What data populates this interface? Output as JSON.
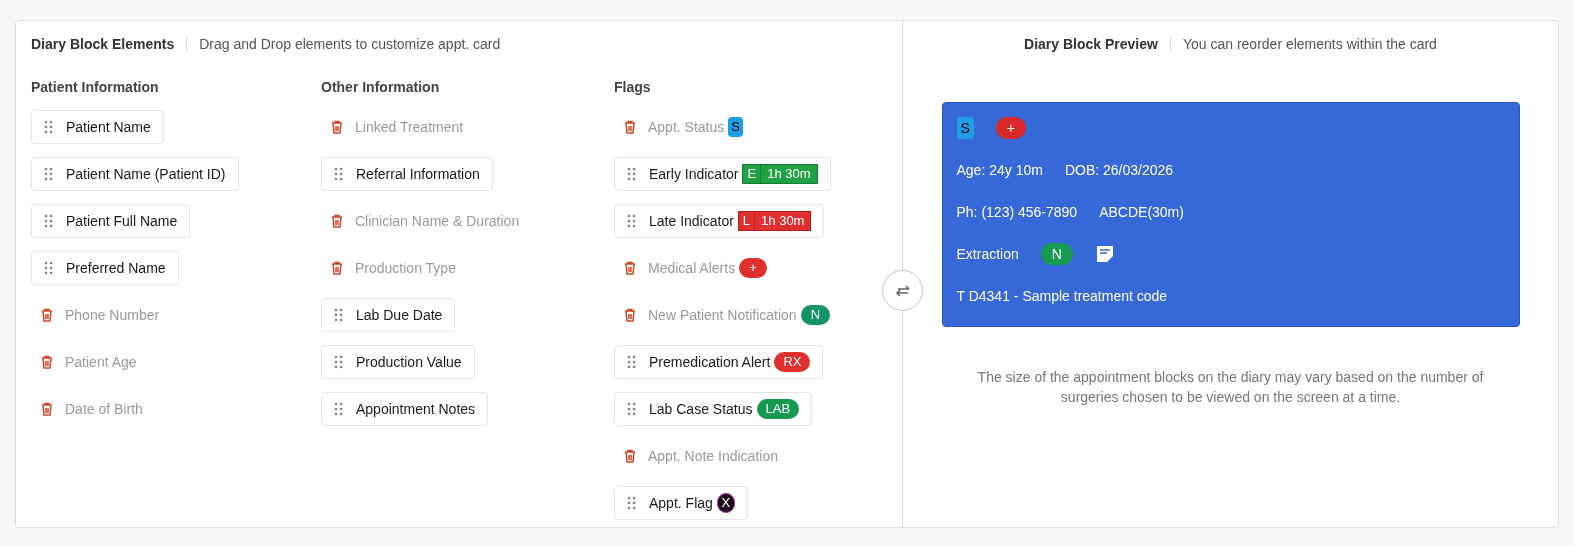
{
  "elements_panel": {
    "title": "Diary Block Elements",
    "subtitle": "Drag and Drop elements to customize appt. card",
    "columns": [
      {
        "heading": "Patient Information",
        "items": [
          {
            "label": "Patient Name",
            "enabled": true
          },
          {
            "label": "Patient Name (Patient ID)",
            "enabled": true
          },
          {
            "label": "Patient Full Name",
            "enabled": true
          },
          {
            "label": "Preferred Name",
            "enabled": true
          },
          {
            "label": "Phone Number",
            "enabled": false
          },
          {
            "label": "Patient Age",
            "enabled": false
          },
          {
            "label": "Date of Birth",
            "enabled": false
          }
        ]
      },
      {
        "heading": "Other Information",
        "items": [
          {
            "label": "Linked Treatment",
            "enabled": false
          },
          {
            "label": "Referral Information",
            "enabled": true
          },
          {
            "label": "Clinician Name & Duration",
            "enabled": false
          },
          {
            "label": "Production Type",
            "enabled": false
          },
          {
            "label": "Lab Due Date",
            "enabled": true
          },
          {
            "label": "Production Value",
            "enabled": true
          },
          {
            "label": "Appointment Notes",
            "enabled": true
          }
        ]
      },
      {
        "heading": "Flags",
        "items": [
          {
            "label": "Appt. Status",
            "enabled": false,
            "badge": {
              "kind": "status",
              "parts": [
                "S"
              ]
            }
          },
          {
            "label": "Early Indicator",
            "enabled": true,
            "badge": {
              "kind": "early",
              "parts": [
                "E",
                "1h 30m"
              ]
            }
          },
          {
            "label": "Late Indicator",
            "enabled": true,
            "badge": {
              "kind": "late",
              "parts": [
                "L",
                "1h 30m"
              ]
            }
          },
          {
            "label": "Medical Alerts",
            "enabled": false,
            "badge": {
              "kind": "alert",
              "parts": [
                "+"
              ]
            }
          },
          {
            "label": "New Patient Notification",
            "enabled": false,
            "badge": {
              "kind": "new",
              "parts": [
                "N"
              ]
            }
          },
          {
            "label": "Premedication Alert",
            "enabled": true,
            "badge": {
              "kind": "premed",
              "parts": [
                "RX"
              ]
            }
          },
          {
            "label": "Lab Case Status",
            "enabled": true,
            "badge": {
              "kind": "lab",
              "parts": [
                "LAB"
              ]
            }
          },
          {
            "label": "Appt. Note Indication",
            "enabled": false
          },
          {
            "label": "Appt. Flag",
            "enabled": true,
            "badge": {
              "kind": "flag",
              "parts": [
                "X"
              ]
            }
          }
        ]
      }
    ]
  },
  "preview_panel": {
    "title": "Diary Block Preview",
    "subtitle": "You can reorder elements within the card",
    "card_rows": [
      [
        {
          "kind": "status",
          "text": "S"
        },
        {
          "kind": "alert",
          "text": "+"
        }
      ],
      [
        {
          "kind": "text",
          "text": "Age: 24y 10m"
        },
        {
          "kind": "text",
          "text": "DOB: 26/03/2026"
        }
      ],
      [
        {
          "kind": "text",
          "text": "Ph: (123) 456-7890"
        },
        {
          "kind": "text",
          "text": "ABCDE(30m)"
        }
      ],
      [
        {
          "kind": "text",
          "text": "Extraction"
        },
        {
          "kind": "new",
          "text": "N"
        },
        {
          "kind": "note"
        }
      ],
      [
        {
          "kind": "text",
          "text": "T D4341 - Sample treatment code"
        }
      ]
    ],
    "note": "The size of the appointment blocks on the diary may vary based on the number of surgeries chosen to be viewed on the screen at a time."
  }
}
